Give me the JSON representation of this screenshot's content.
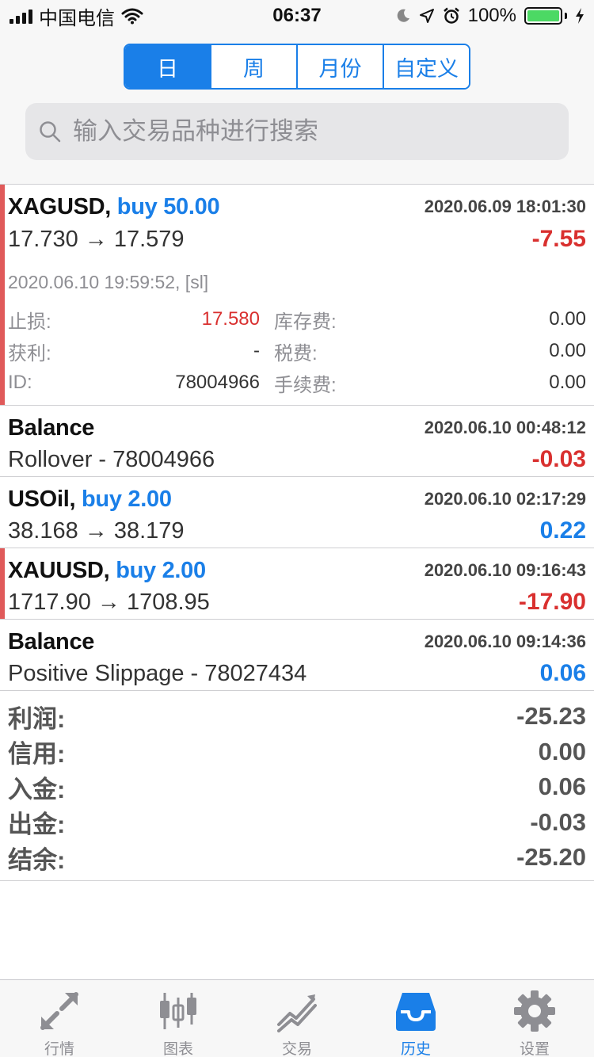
{
  "status_bar": {
    "carrier": "中国电信",
    "time": "06:37",
    "battery": "100%"
  },
  "period_tabs": [
    {
      "label": "日",
      "active": true
    },
    {
      "label": "周",
      "active": false
    },
    {
      "label": "月份",
      "active": false
    },
    {
      "label": "自定义",
      "active": false
    }
  ],
  "search": {
    "placeholder": "输入交易品种进行搜索"
  },
  "trades": [
    {
      "symbol": "XAGUSD,",
      "direction": "buy 50.00",
      "date": "2020.06.09 18:01:30",
      "prices": "17.730 → 17.579",
      "pl": "-7.55",
      "closed_info": "2020.06.10 19:59:52, [sl]",
      "details": {
        "sl_label": "止损:",
        "sl_value": "17.580",
        "swap_label": "库存费:",
        "swap_value": "0.00",
        "tp_label": "获利:",
        "tp_value": "-",
        "tax_label": "税费:",
        "tax_value": "0.00",
        "id_label": "ID:",
        "id_value": "78004966",
        "commission_label": "手续费:",
        "commission_value": "0.00"
      }
    },
    {
      "symbol": "Balance",
      "date": "2020.06.10 00:48:12",
      "sub": "Rollover - 78004966",
      "pl": "-0.03"
    },
    {
      "symbol": "USOil,",
      "direction": "buy 2.00",
      "date": "2020.06.10 02:17:29",
      "prices": "38.168 → 38.179",
      "pl": "0.22"
    },
    {
      "symbol": "XAUUSD,",
      "direction": "buy 2.00",
      "date": "2020.06.10 09:16:43",
      "prices": "1717.90 → 1708.95",
      "pl": "-17.90"
    },
    {
      "symbol": "Balance",
      "date": "2020.06.10 09:14:36",
      "sub": "Positive Slippage - 78027434",
      "pl": "0.06"
    }
  ],
  "summary": [
    {
      "label": "利润:",
      "value": "-25.23"
    },
    {
      "label": "信用:",
      "value": "0.00"
    },
    {
      "label": "入金:",
      "value": "0.06"
    },
    {
      "label": "出金:",
      "value": "-0.03"
    },
    {
      "label": "结余:",
      "value": "-25.20"
    }
  ],
  "tab_bar": [
    {
      "label": "行情",
      "icon": "quotes-icon",
      "active": false
    },
    {
      "label": "图表",
      "icon": "chart-icon",
      "active": false
    },
    {
      "label": "交易",
      "icon": "trade-icon",
      "active": false
    },
    {
      "label": "历史",
      "icon": "history-icon",
      "active": true
    },
    {
      "label": "设置",
      "icon": "settings-icon",
      "active": false
    }
  ],
  "colors": {
    "accent": "#1a7fe8",
    "loss": "#d9302f",
    "marker": "#e05a5a"
  }
}
